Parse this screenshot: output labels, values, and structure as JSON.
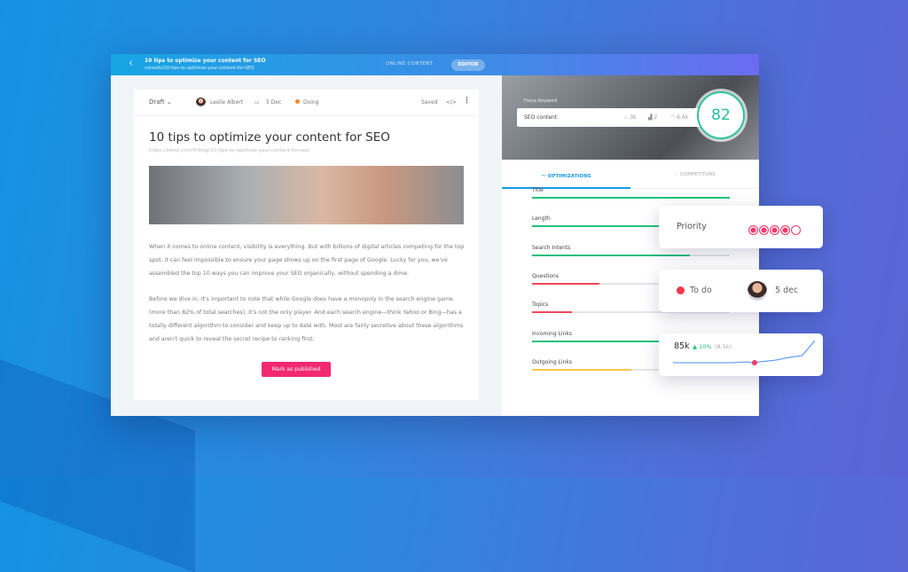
{
  "header": {
    "title": "10 tips to optimize your content for SEO",
    "path": "conseils/10-tips-to-optimize-your-content-for-SEO",
    "tab_online": "ONLINE CONTENT",
    "tab_editor": "EDITOR"
  },
  "toolbar": {
    "status": "Draft",
    "author": "Leslie Albert",
    "date": "5 Dec",
    "state": "Doing",
    "saved": "Saved"
  },
  "article": {
    "title": "10 tips to optimize your content for SEO",
    "url": "https://semji.com/fr/blog/10-tips-to-optimize-your-content-for-seo/",
    "p1": "When it comes to online content, visibility is everything. But with billions of digital articles competing for the top spot, it can feel impossible to ensure your page shows up on the first page of Google. Lucky for you, we've assembled the top 10 ways you can improve your SEO organically, without spending a dime.",
    "p2": "Before we dive in, it's important to note that while Google does have a monopoly in the search engine game (more than 82% of total searches), it's not the only player. And each search engine—think Yahoo or Bing—has a totally different algorithm to consider and keep up to date with. Most are fairly secretive about these algorithms and aren't quick to reveal the secret recipe to ranking first.",
    "publish": "Mark as published"
  },
  "keyword": {
    "label": "Focus Keyword",
    "value": "SEO content",
    "volume": "3k",
    "rank": "2",
    "clicks": "6.6k",
    "score": "82"
  },
  "tabs": {
    "optimizations": "OPTIMIZATIONS",
    "competitors": "COMPETITORS"
  },
  "metrics": [
    {
      "name": "Title",
      "value": "",
      "fill": 1,
      "color": "#21c17c"
    },
    {
      "name": "Length",
      "value": "",
      "fill": 1,
      "color": "#21c17c"
    },
    {
      "name": "Search Intents",
      "value": "8/10",
      "fill": 0.8,
      "color": "#21c17c"
    },
    {
      "name": "Questions",
      "value": "",
      "fill": 0.34,
      "color": "#f5455b"
    },
    {
      "name": "Topics",
      "value": "15/50",
      "fill": 0.2,
      "color": "#f5455b"
    },
    {
      "name": "Incoming Links",
      "value": "",
      "fill": 1,
      "color": "#21c17c"
    },
    {
      "name": "Outgoing Links",
      "value": "2/4",
      "fill": 0.5,
      "color": "#f3c94a"
    }
  ],
  "priority": {
    "label": "Priority",
    "level": 4,
    "max": 5
  },
  "task": {
    "status": "To do",
    "date": "5 dec"
  },
  "traffic": {
    "value": "85k",
    "change": "▲ 10%",
    "prev": "(8.5k)"
  }
}
